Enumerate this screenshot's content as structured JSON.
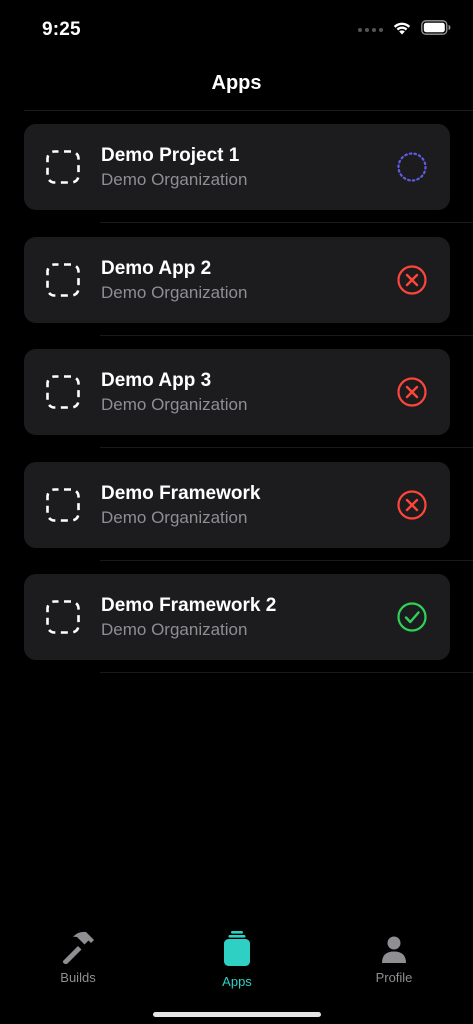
{
  "status_bar": {
    "time": "9:25"
  },
  "nav": {
    "title": "Apps"
  },
  "apps": [
    {
      "name": "Demo Project 1",
      "organization": "Demo Organization",
      "status": "pending",
      "status_icon": "dotted-circle-icon"
    },
    {
      "name": "Demo App 2",
      "organization": "Demo Organization",
      "status": "failed",
      "status_icon": "x-circle-icon"
    },
    {
      "name": "Demo App 3",
      "organization": "Demo Organization",
      "status": "failed",
      "status_icon": "x-circle-icon"
    },
    {
      "name": "Demo Framework",
      "organization": "Demo Organization",
      "status": "failed",
      "status_icon": "x-circle-icon"
    },
    {
      "name": "Demo Framework 2",
      "organization": "Demo Organization",
      "status": "success",
      "status_icon": "check-circle-icon"
    }
  ],
  "tabs": [
    {
      "label": "Builds",
      "icon": "hammer-icon",
      "active": false
    },
    {
      "label": "Apps",
      "icon": "apps-stack-icon",
      "active": true
    },
    {
      "label": "Profile",
      "icon": "person-icon",
      "active": false
    }
  ],
  "colors": {
    "pending": "#5e5ce6",
    "failed": "#ff453a",
    "success": "#30d158",
    "accent": "#2fd0c4",
    "card": "#1c1c1e",
    "secondary_text": "#8e8e93"
  }
}
